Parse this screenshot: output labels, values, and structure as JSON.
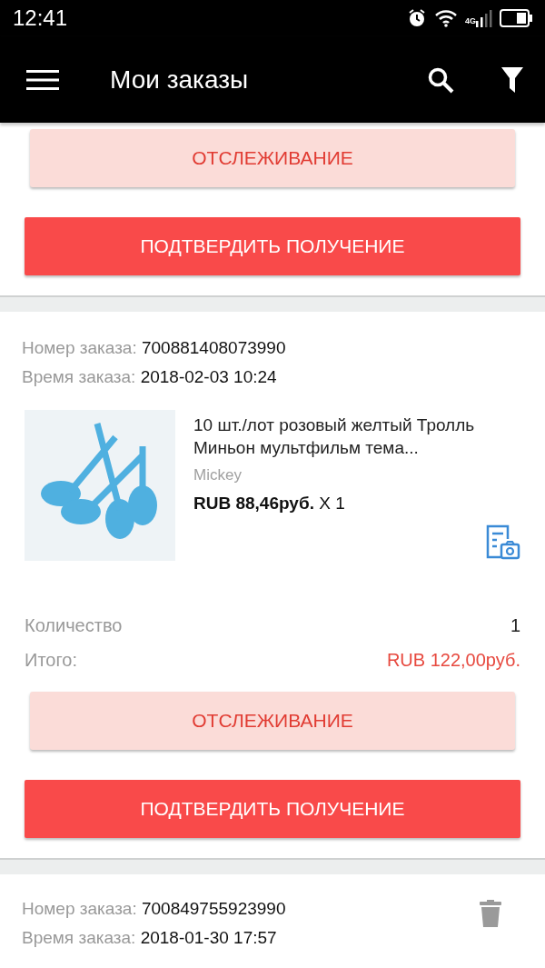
{
  "status_bar": {
    "time": "12:41",
    "network": "4G"
  },
  "app_bar": {
    "title": "Мои заказы"
  },
  "orders": [
    {
      "kind": "buttons_only",
      "track_button": "ОТСЛЕЖИВАНИЕ",
      "confirm_button": "ПОДТВЕРДИТЬ ПОЛУЧЕНИЕ"
    },
    {
      "kind": "full",
      "number_label": "Номер заказа:",
      "number": "700881408073990",
      "time_label": "Время заказа:",
      "time": "2018-02-03 10:24",
      "product": {
        "title": "10 шт./лот розовый желтый Тролль Миньон мультфильм тема...",
        "variant": "Mickey",
        "price": "RUB 88,46руб.",
        "quantity": "X 1"
      },
      "quantity_label": "Количество",
      "quantity_value": "1",
      "total_label": "Итого:",
      "total_value": "RUB 122,00руб.",
      "track_button": "ОТСЛЕЖИВАНИЕ",
      "confirm_button": "ПОДТВЕРДИТЬ ПОЛУЧЕНИЕ"
    },
    {
      "kind": "header_only",
      "number_label": "Номер заказа:",
      "number": "700849755923990",
      "time_label": "Время заказа:",
      "time": "2018-01-30 17:57",
      "deletable": true
    }
  ]
}
